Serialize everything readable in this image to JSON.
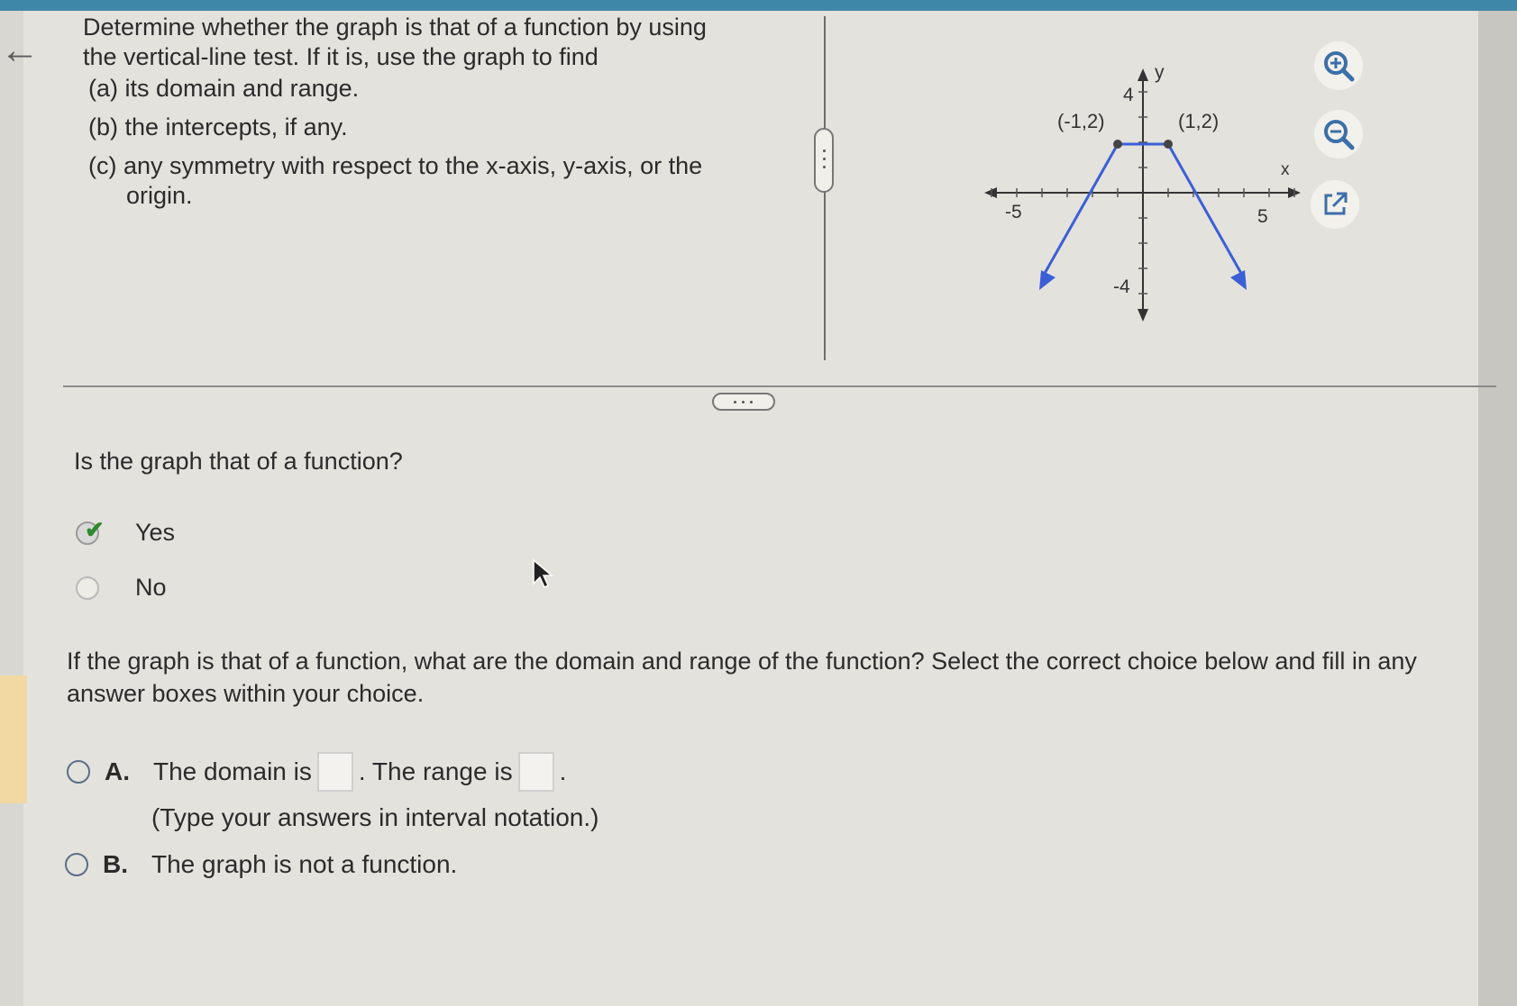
{
  "nav": {
    "back_icon": "back-arrow-icon"
  },
  "prompt": {
    "line1": "Determine whether the graph is that of a function by using",
    "line2": "the vertical-line test. If it is, use the graph to find",
    "part_a": "(a) its domain and range.",
    "part_b": "(b) the intercepts, if any.",
    "part_c1": "(c) any symmetry with respect to the x-axis, y-axis, or the",
    "part_c2": "origin."
  },
  "graph": {
    "y_label": "y",
    "x_label": "x",
    "tick_x_neg": "-5",
    "tick_x_pos": "5",
    "tick_y_pos": "4",
    "tick_y_neg": "-4",
    "point_left_label": "(-1,2)",
    "point_right_label": "(1,2)",
    "line_color": "#3b5fd6",
    "buttons": {
      "zoom_in": "zoom-in-icon",
      "zoom_out": "zoom-out-icon",
      "open": "external-link-icon"
    }
  },
  "question1": {
    "text": "Is the graph that of a function?",
    "options": [
      {
        "label": "Yes",
        "selected": true
      },
      {
        "label": "No",
        "selected": false
      }
    ]
  },
  "question2": {
    "text": "If the graph is that of a function, what are the domain and range of the function? Select the correct choice below and fill in any answer boxes within your choice.",
    "choice_a": {
      "letter": "A.",
      "domain_text": "The domain is",
      "range_text": ". The range is",
      "end": ".",
      "hint": "(Type your answers in interval notation.)"
    },
    "choice_b": {
      "letter": "B.",
      "text": "The graph is not a function."
    }
  }
}
